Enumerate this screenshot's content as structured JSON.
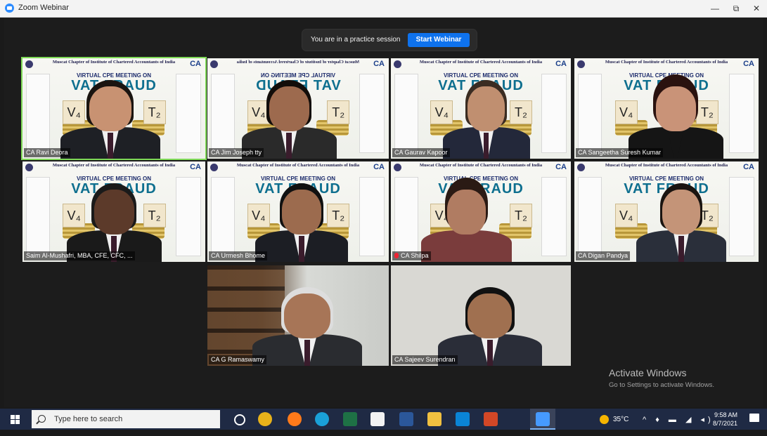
{
  "window": {
    "title": "Zoom Webinar",
    "minimize": "—",
    "restore": "⧉",
    "close": "✕"
  },
  "banner": {
    "text": "You are in a practice session",
    "button": "Start Webinar"
  },
  "slide": {
    "header": "Muscat Chapter of Institute of Chartered Accountants of India",
    "header_mirrored": "Muscat Chapter of Institute of Chartered Accountants of India",
    "subtitle": "VIRTUAL CPE MEETING ON",
    "title": "VAT FRAUD",
    "tile_left": "V₄",
    "tile_right": "T₂",
    "brand": "CA"
  },
  "participants": [
    {
      "name": "CA Ravi Deora",
      "active": true
    },
    {
      "name": "CA Jim Joseph tty"
    },
    {
      "name": "CA Gaurav Kapoor"
    },
    {
      "name": "CA Sangeetha Suresh Kumar"
    },
    {
      "name": "Saim Al-Mushafri, MBA, CFE, CFC, ..."
    },
    {
      "name": "CA Urmesh Bhome"
    },
    {
      "name": "CA Shilpa",
      "muted": true
    },
    {
      "name": "CA Digan Pandya"
    },
    {
      "name": "CA G Ramaswamy"
    },
    {
      "name": "CA Sajeev Surendran"
    }
  ],
  "watermark": {
    "title": "Activate Windows",
    "subtitle": "Go to Settings to activate Windows."
  },
  "taskbar": {
    "search_placeholder": "Type here to search",
    "weather": "35°C",
    "time": "9:58 AM",
    "date": "8/7/2021",
    "icons": [
      "task-view-icon",
      "chrome-icon",
      "firefox-icon",
      "edge-icon",
      "excel-icon",
      "store-icon",
      "word-icon",
      "files-icon",
      "mail-icon",
      "powerpoint-icon",
      "zoom-icon"
    ]
  }
}
